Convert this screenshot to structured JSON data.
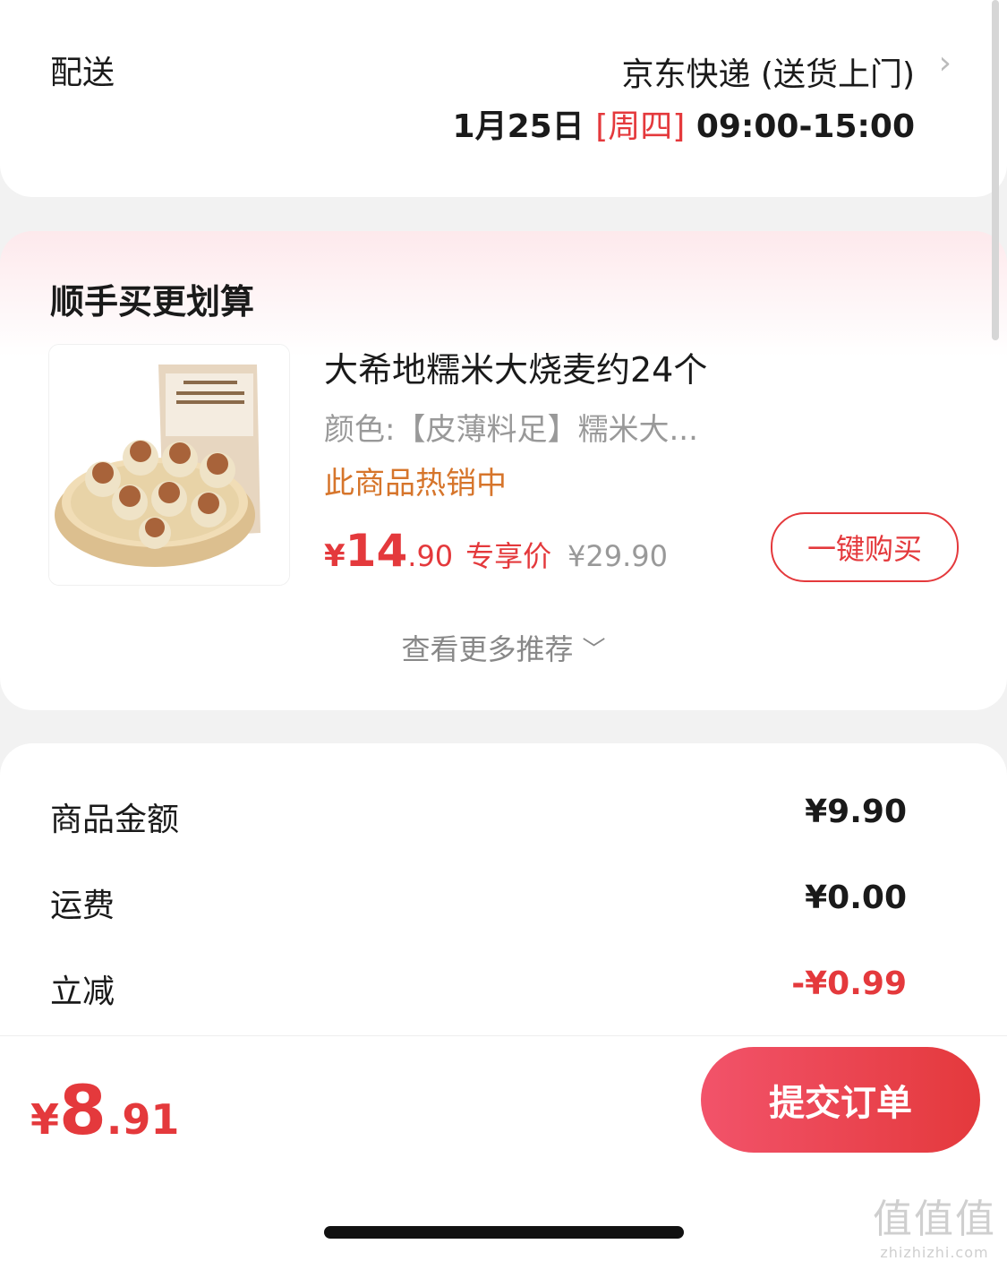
{
  "delivery": {
    "label": "配送",
    "method": "京东快递 (送货上门)",
    "date": "1月25日",
    "weekday": "[周四]",
    "time_range": "09:00-15:00"
  },
  "recommend": {
    "title": "顺手买更划算",
    "product": {
      "name": "大希地糯米大烧麦约24个",
      "spec": "颜色:【皮薄料足】糯米大...",
      "hot_text": "此商品热销中",
      "price_symbol": "¥",
      "price_int": "14",
      "price_dec": ".90",
      "price_tag": "专享价",
      "original_price": "¥29.90",
      "buy_label": "一键购买"
    },
    "more_label": "查看更多推荐"
  },
  "summary": {
    "goods_label": "商品金额",
    "goods_value": "¥9.90",
    "shipping_label": "运费",
    "shipping_value": "¥0.00",
    "discount_label": "立减",
    "discount_value": "-¥0.99"
  },
  "bottom": {
    "total_symbol": "¥",
    "total_int": "8",
    "total_dec": ".91",
    "submit_label": "提交订单"
  },
  "watermark": {
    "logo": "值值值",
    "url": "zhizhizhi.com"
  },
  "colors": {
    "accent": "#e4393c",
    "hot": "#d6752b",
    "muted": "#999999"
  }
}
